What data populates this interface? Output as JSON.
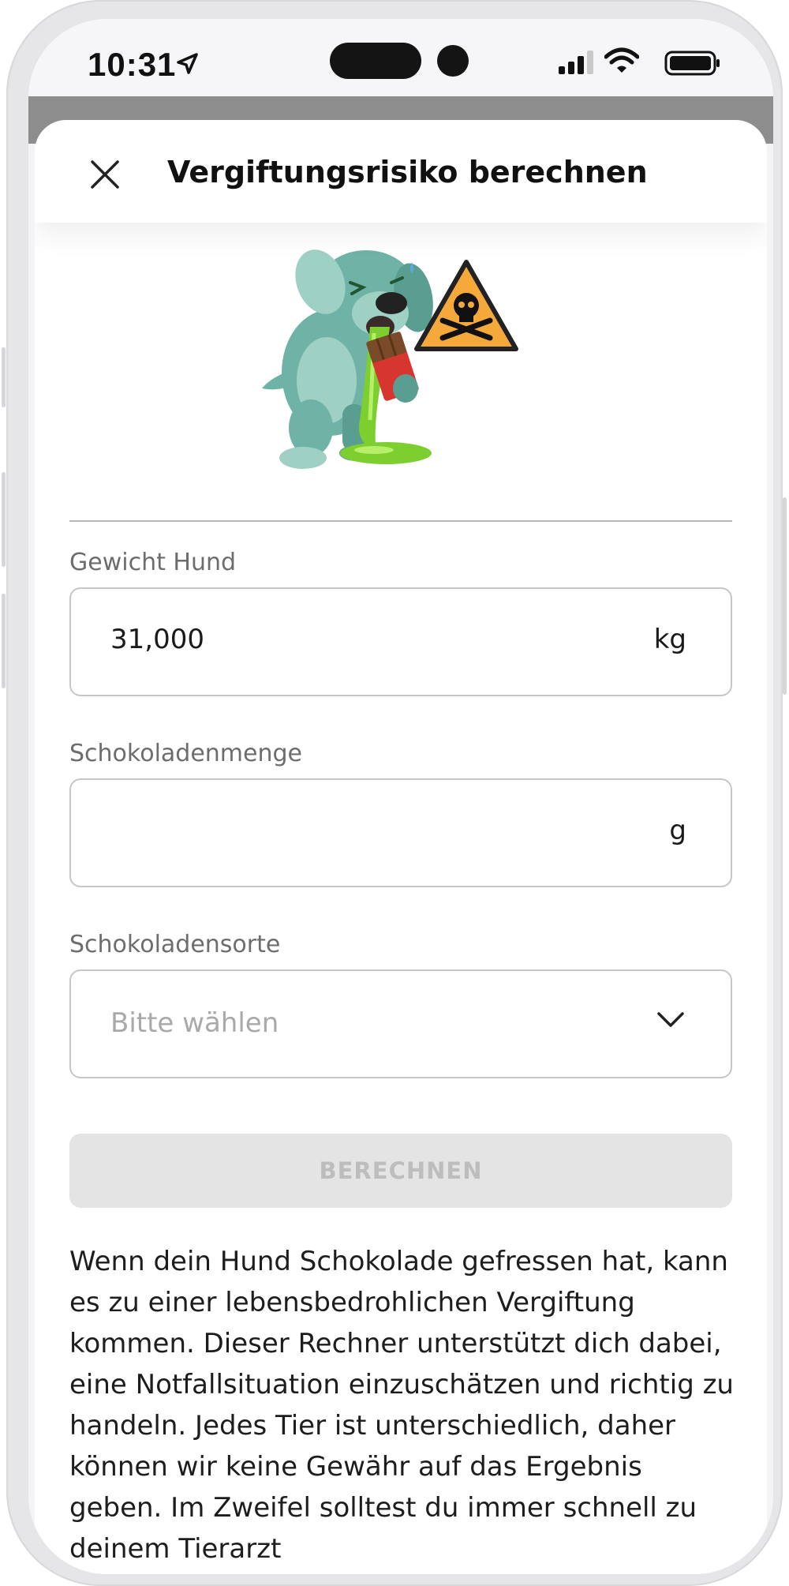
{
  "status_bar": {
    "time": "10:31"
  },
  "sheet": {
    "title": "Vergiftungsrisiko berechnen"
  },
  "form": {
    "weight": {
      "label": "Gewicht Hund",
      "value": "31,000",
      "unit": "kg"
    },
    "chocolate_amount": {
      "label": "Schokoladenmenge",
      "value": "",
      "unit": "g"
    },
    "chocolate_type": {
      "label": "Schokoladensorte",
      "placeholder": "Bitte wählen"
    },
    "submit_label": "BERECHNEN"
  },
  "info": {
    "text": "Wenn dein Hund Schokolade gefressen hat, kann es zu einer lebensbedrohlichen Vergiftung kommen. Dieser Rechner unterstützt dich dabei, eine Notfallsituation einzuschätzen und richtig zu handeln. Jedes Tier ist unterschiedlich, daher können wir keine Gewähr auf das Ergebnis geben. Im Zweifel solltest du immer schnell zu deinem Tierarzt"
  },
  "colors": {
    "dog": "#6fb3a6",
    "warning": "#f6a93b",
    "vomit": "#7ccf2e",
    "button_disabled_bg": "#e4e4e4",
    "button_disabled_text": "#bdbdbd"
  },
  "icons": [
    "location-arrow-icon",
    "signal-icon",
    "wifi-icon",
    "battery-icon",
    "close-icon",
    "chevron-down-icon",
    "poison-warning-icon"
  ]
}
